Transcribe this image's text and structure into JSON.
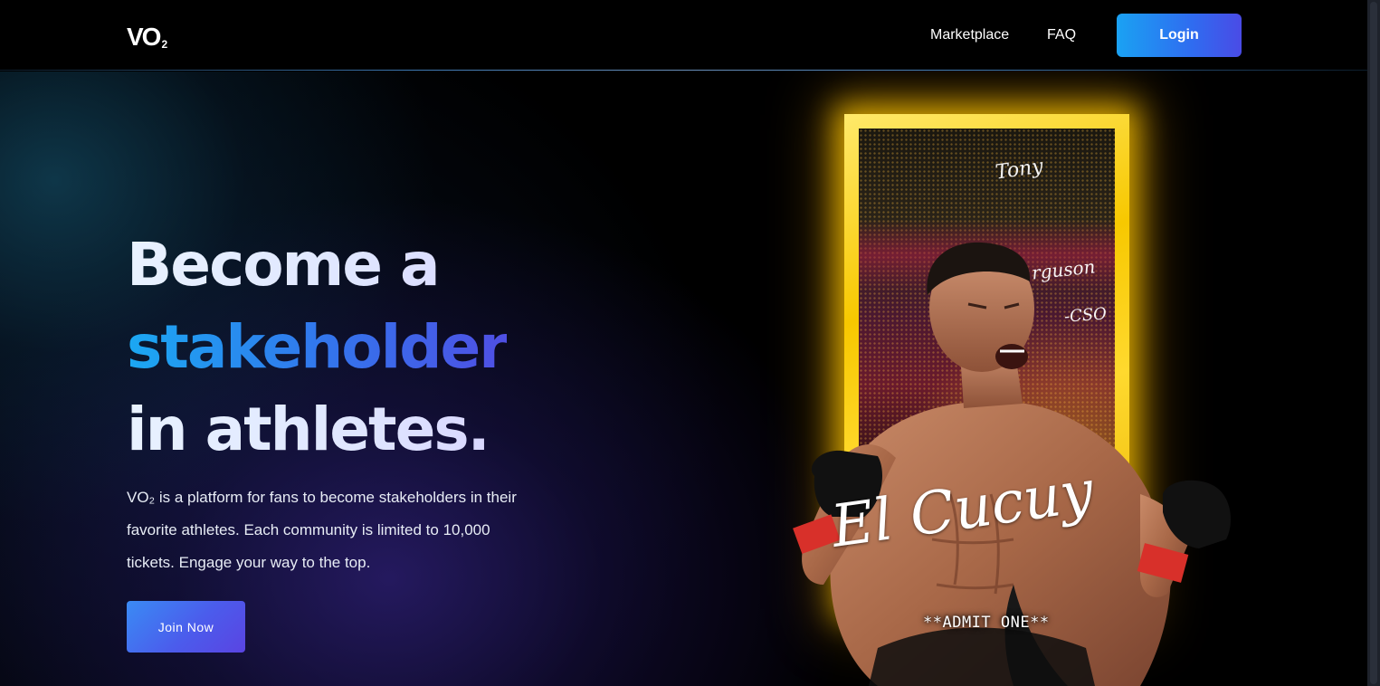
{
  "header": {
    "logo_text": "VO",
    "logo_sub": "2",
    "nav": [
      {
        "label": "Marketplace"
      },
      {
        "label": "FAQ"
      }
    ],
    "login_label": "Login"
  },
  "hero": {
    "headline": {
      "line1": "Become a",
      "line2": "stakeholder",
      "line3": "in athletes."
    },
    "description": "VO₂ is a platform for fans to become stakeholders in their favorite athletes. Each community is limited to 10,000 tickets. Engage your way to the top.",
    "cta_label": "Join Now"
  },
  "card": {
    "signature_first": "Tony",
    "signature_last": "rguson",
    "signature_tag": "-CSO",
    "nickname": "El Cucuy",
    "footer": "**ADMIT ONE**",
    "frame_color": "#f7c800",
    "image_subject": "fighter-photo"
  },
  "colors": {
    "accent_blue": "#1ba8f2",
    "accent_indigo": "#4f4fe4",
    "background": "#000000"
  }
}
